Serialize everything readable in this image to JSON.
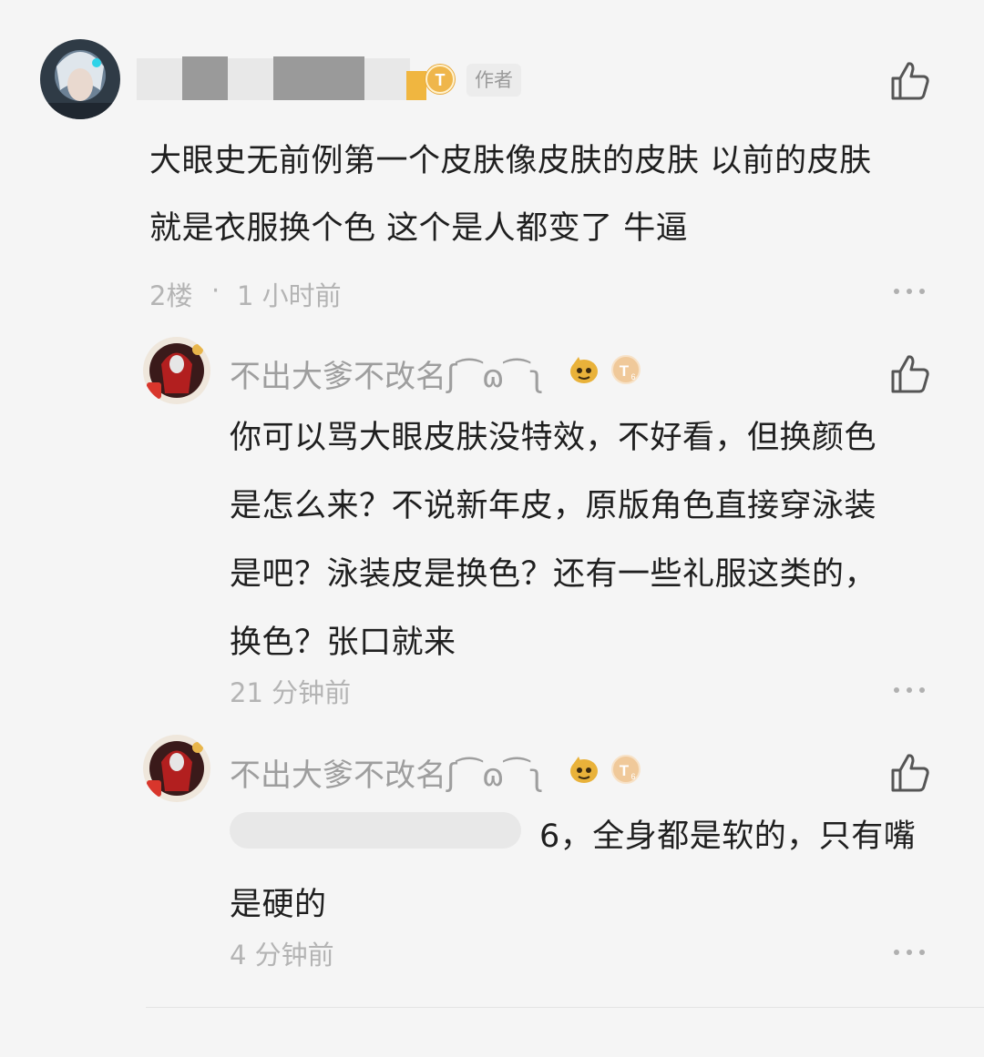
{
  "comment": {
    "author_tag": "作者",
    "body_line1": "大眼史无前例第一个皮肤像皮肤的皮肤 以前的皮肤",
    "body_line2": "就是衣服换个色 这个是人都变了 牛逼",
    "floor": "2楼",
    "meta_dot": "·",
    "time": "1 小时前"
  },
  "replies": [
    {
      "username": "不出大爹不改名ʃ⁀ɷ⁀ʅ",
      "lines": [
        "你可以骂大眼皮肤没特效，不好看，但换颜色",
        "是怎么来？不说新年皮，原版角色直接穿泳装",
        "是吧？泳装皮是换色？还有一些礼服这类的，",
        "换色？张口就来"
      ],
      "time": "21 分钟前"
    },
    {
      "username": "不出大爹不改名ʃ⁀ɷ⁀ʅ",
      "line1_tail": "6，全身都是软的，只有嘴",
      "line2": "是硬的",
      "time": "4 分钟前"
    }
  ],
  "colors": {
    "background": "#f5f5f5",
    "body_text": "#1f1f1f",
    "meta_text": "#b4b4b4",
    "badge_gold": "#e8a93a"
  },
  "icons": [
    "thumbs-up-icon",
    "more-dots-icon",
    "level-badge-icon",
    "emoji-badge-icon"
  ]
}
